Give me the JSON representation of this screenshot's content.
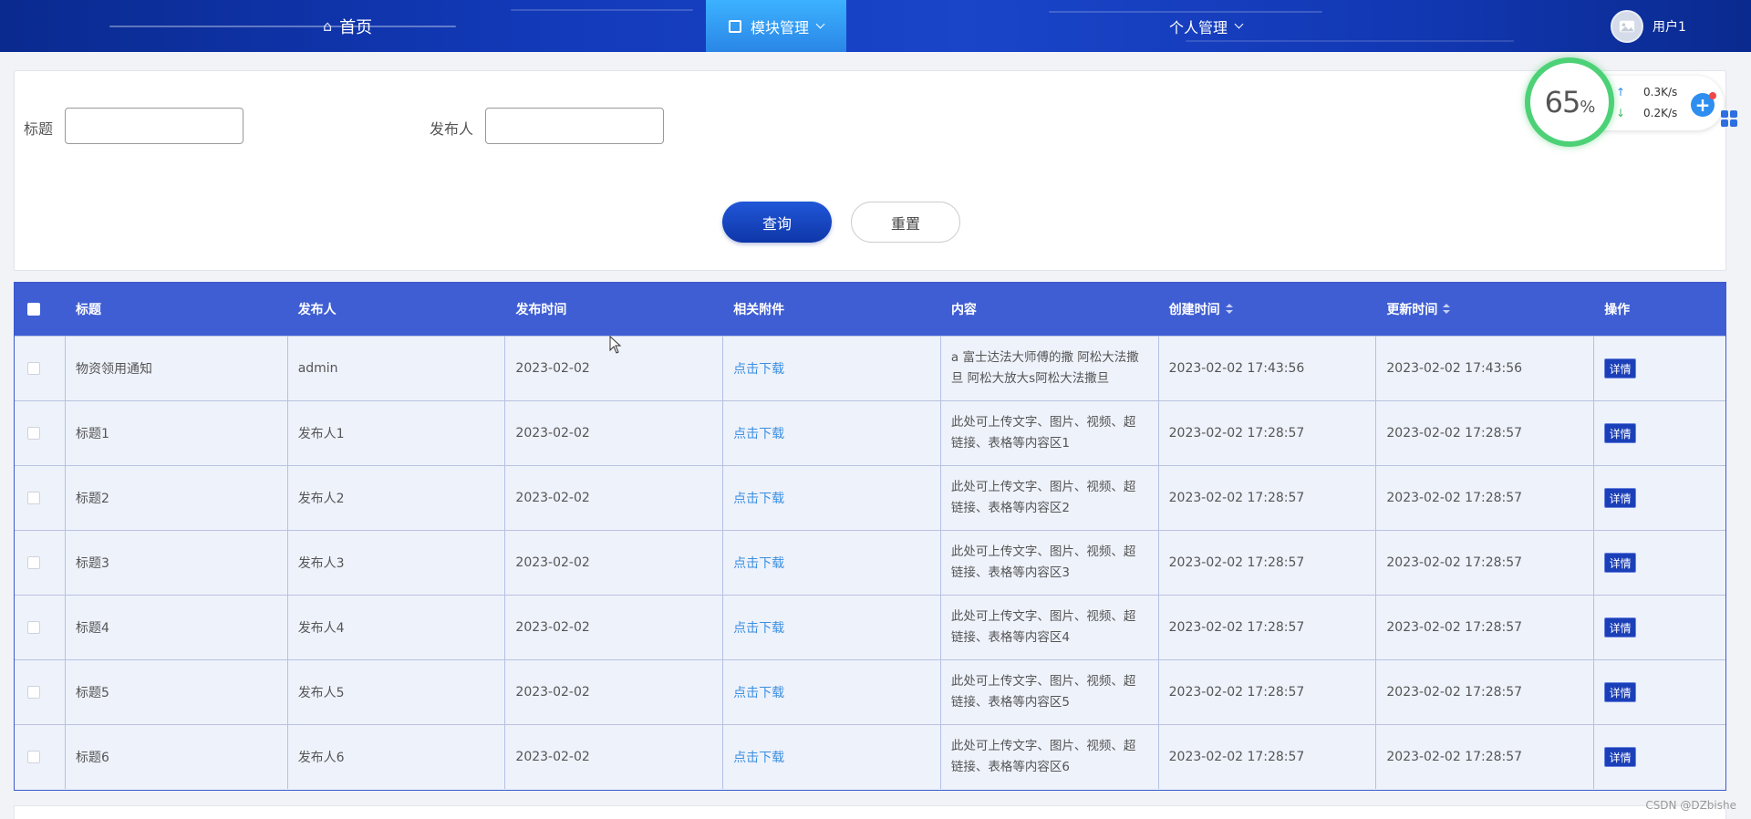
{
  "nav": {
    "home": "首页",
    "module": "模块管理",
    "personal": "个人管理",
    "user": "用户1"
  },
  "search": {
    "title_label": "标题",
    "publisher_label": "发布人",
    "title_value": "",
    "publisher_value": "",
    "query_label": "查询",
    "reset_label": "重置"
  },
  "table": {
    "headers": [
      "标题",
      "发布人",
      "发布时间",
      "相关附件",
      "内容",
      "创建时间",
      "更新时间",
      "操作"
    ],
    "rows": [
      {
        "title": "物资领用通知",
        "publisher": "admin",
        "date": "2023-02-02",
        "attachment": "点击下载",
        "content": "a 富士达法大师傅的撒 阿松大法撒旦 阿松大放大s阿松大法撒旦",
        "created": "2023-02-02 17:43:56",
        "updated": "2023-02-02 17:43:56",
        "action": "详情"
      },
      {
        "title": "标题1",
        "publisher": "发布人1",
        "date": "2023-02-02",
        "attachment": "点击下载",
        "content": "此处可上传文字、图片、视频、超链接、表格等内容区1",
        "created": "2023-02-02 17:28:57",
        "updated": "2023-02-02 17:28:57",
        "action": "详情"
      },
      {
        "title": "标题2",
        "publisher": "发布人2",
        "date": "2023-02-02",
        "attachment": "点击下载",
        "content": "此处可上传文字、图片、视频、超链接、表格等内容区2",
        "created": "2023-02-02 17:28:57",
        "updated": "2023-02-02 17:28:57",
        "action": "详情"
      },
      {
        "title": "标题3",
        "publisher": "发布人3",
        "date": "2023-02-02",
        "attachment": "点击下载",
        "content": "此处可上传文字、图片、视频、超链接、表格等内容区3",
        "created": "2023-02-02 17:28:57",
        "updated": "2023-02-02 17:28:57",
        "action": "详情"
      },
      {
        "title": "标题4",
        "publisher": "发布人4",
        "date": "2023-02-02",
        "attachment": "点击下载",
        "content": "此处可上传文字、图片、视频、超链接、表格等内容区4",
        "created": "2023-02-02 17:28:57",
        "updated": "2023-02-02 17:28:57",
        "action": "详情"
      },
      {
        "title": "标题5",
        "publisher": "发布人5",
        "date": "2023-02-02",
        "attachment": "点击下载",
        "content": "此处可上传文字、图片、视频、超链接、表格等内容区5",
        "created": "2023-02-02 17:28:57",
        "updated": "2023-02-02 17:28:57",
        "action": "详情"
      },
      {
        "title": "标题6",
        "publisher": "发布人6",
        "date": "2023-02-02",
        "attachment": "点击下载",
        "content": "此处可上传文字、图片、视频、超链接、表格等内容区6",
        "created": "2023-02-02 17:28:57",
        "updated": "2023-02-02 17:28:57",
        "action": "详情"
      }
    ]
  },
  "widget": {
    "percent": "65",
    "percent_unit": "%",
    "upload": "0.3K/s",
    "download": "0.2K/s"
  },
  "watermark": "CSDN @DZbishe",
  "colors": {
    "nav": "#1239b8",
    "table_header": "#3f5ed3",
    "link": "#3c8fe0",
    "gauge": "#4cd177"
  }
}
